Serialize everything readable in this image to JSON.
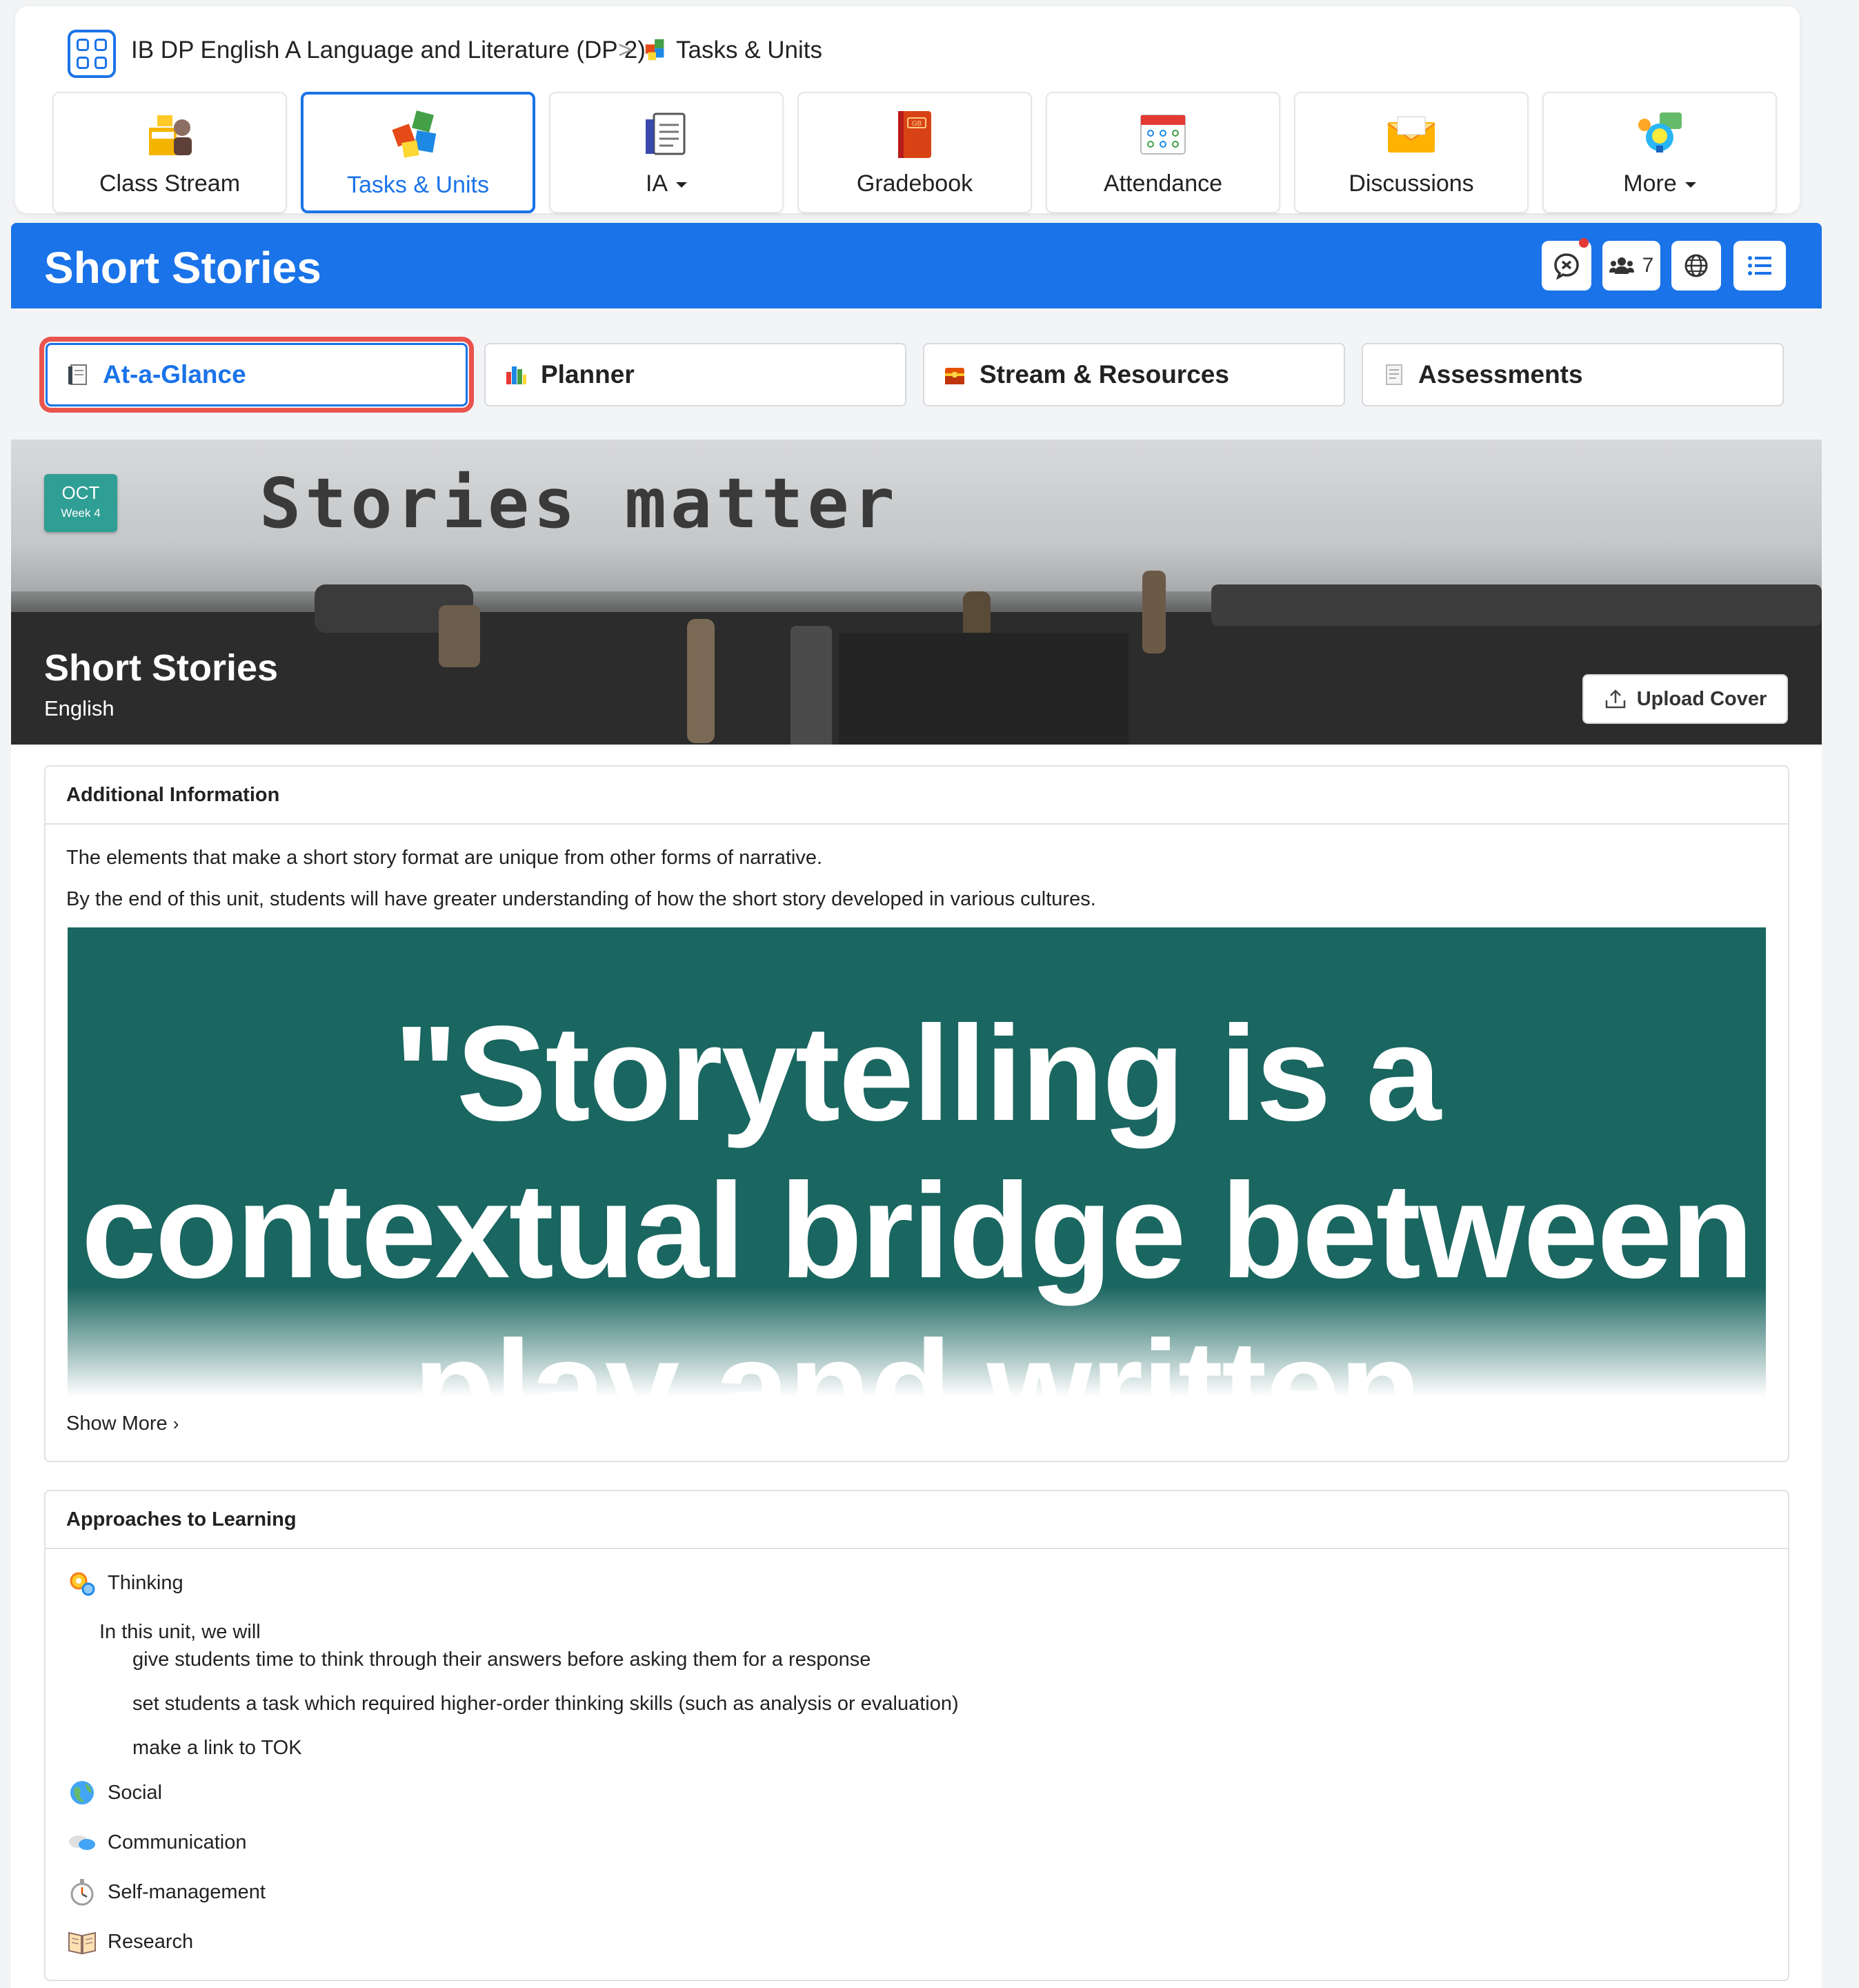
{
  "breadcrumb": {
    "course": "IB DP English A Language and Literature (DP 2)",
    "separator": ">",
    "current": "Tasks & Units"
  },
  "nav": [
    {
      "label": "Class Stream",
      "icon": "class-stream-icon"
    },
    {
      "label": "Tasks & Units",
      "icon": "puzzle-icon",
      "active": true
    },
    {
      "label": "IA",
      "icon": "ia-document-icon",
      "dropdown": true
    },
    {
      "label": "Gradebook",
      "icon": "gradebook-icon"
    },
    {
      "label": "Attendance",
      "icon": "attendance-calendar-icon"
    },
    {
      "label": "Discussions",
      "icon": "envelope-icon"
    },
    {
      "label": "More",
      "icon": "lightbulb-chat-icon",
      "dropdown": true
    }
  ],
  "header": {
    "title": "Short Stories",
    "member_count": "7"
  },
  "subtabs": [
    {
      "label": "At-a-Glance",
      "active": true
    },
    {
      "label": "Planner"
    },
    {
      "label": "Stream & Resources"
    },
    {
      "label": "Assessments"
    }
  ],
  "banner": {
    "typed_text": "Stories matter",
    "date_month": "OCT",
    "date_week": "Week 4",
    "title": "Short Stories",
    "subject": "English",
    "upload_label": "Upload Cover"
  },
  "additional_info": {
    "heading": "Additional Information",
    "para1": "The elements that make a short story format are unique from other forms of narrative.",
    "para2": "By the end of this unit, students will have greater understanding of how the short story developed in various cultures.",
    "quote": "\"Storytelling is a contextual bridge between play and written narrative.\"",
    "show_more": "Show More"
  },
  "atl": {
    "heading": "Approaches to Learning",
    "thinking": "Thinking",
    "intro": "In this unit, we will",
    "items": [
      "give students time to think through their answers before asking them for a response",
      "set students a task which required higher-order thinking skills (such as analysis or evaluation)",
      "make a link to TOK"
    ],
    "social": "Social",
    "communication": "Communication",
    "self_management": "Self-management",
    "research": "Research"
  },
  "colors": {
    "primary": "#1a73e8",
    "highlight": "#e9544c",
    "quote_bg": "#1a6660",
    "date_badge": "#2f9e95"
  }
}
